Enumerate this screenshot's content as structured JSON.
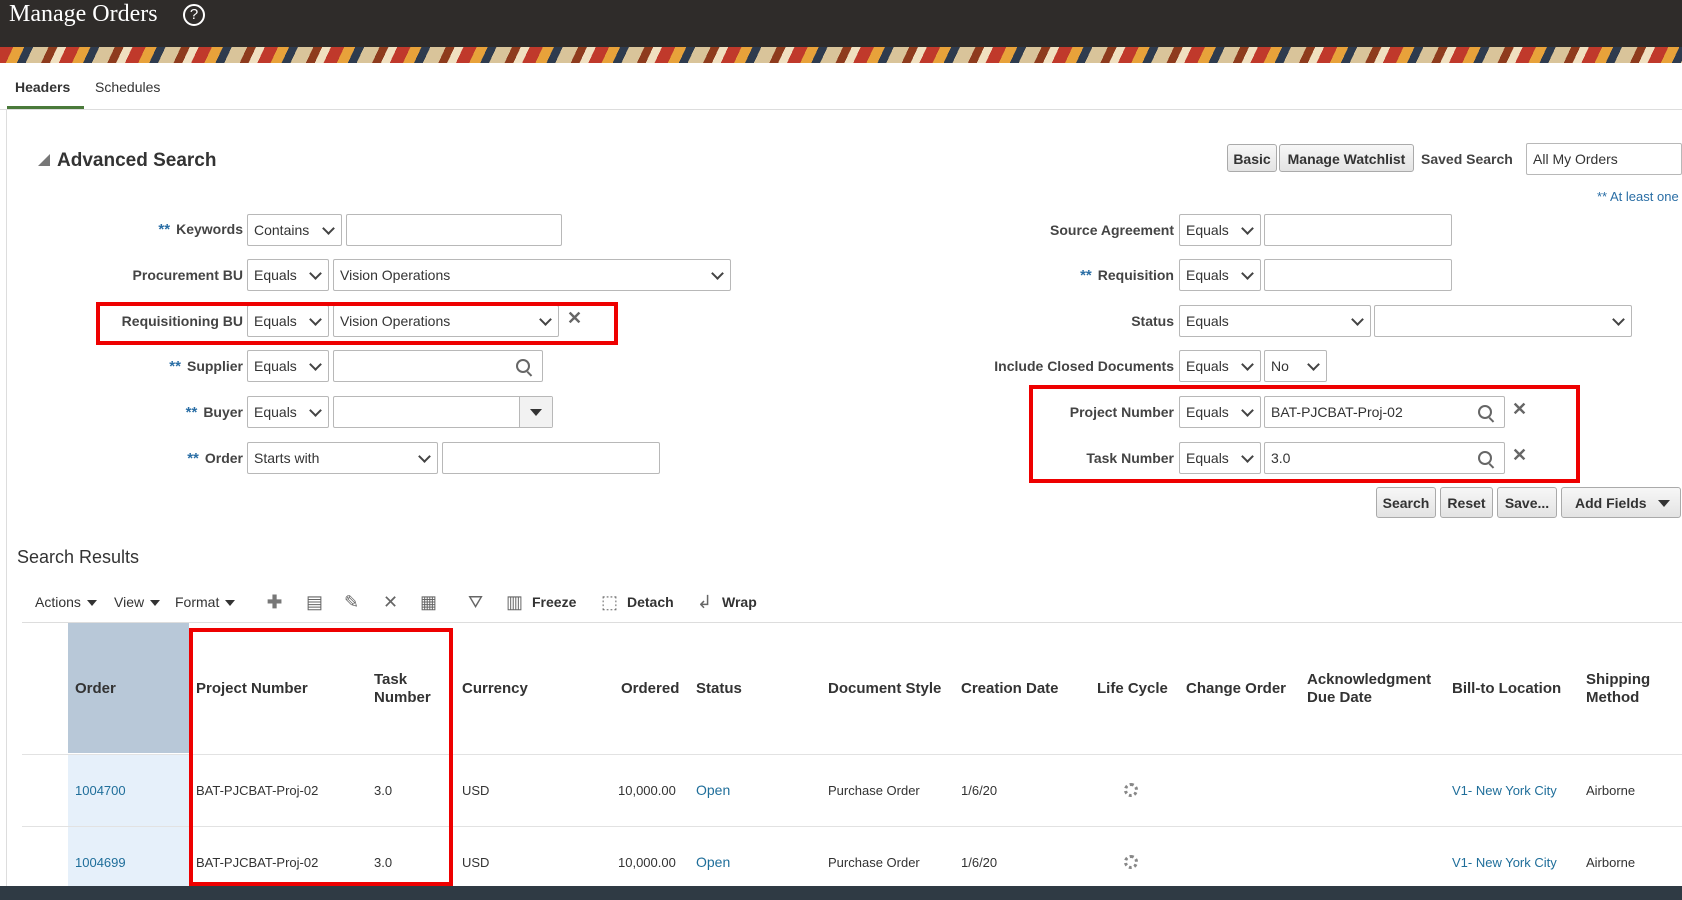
{
  "page": {
    "title": "Manage Orders",
    "help": "?"
  },
  "tabs": [
    {
      "label": "Headers"
    },
    {
      "label": "Schedules"
    }
  ],
  "advanced_search": {
    "title": "Advanced Search",
    "basic_label": "Basic",
    "manage_watchlist_label": "Manage Watchlist",
    "saved_search_label": "Saved Search",
    "saved_search_value": "All My Orders",
    "at_least_one_note": "** At least one",
    "required_marker": "**",
    "fields_left": {
      "keywords": {
        "label": "Keywords",
        "operator": "Contains",
        "value": ""
      },
      "procurement_bu": {
        "label": "Procurement BU",
        "operator": "Equals",
        "value": "Vision Operations"
      },
      "requisitioning_bu": {
        "label": "Requisitioning BU",
        "operator": "Equals",
        "value": "Vision Operations"
      },
      "supplier": {
        "label": "Supplier",
        "operator": "Equals",
        "value": ""
      },
      "buyer": {
        "label": "Buyer",
        "operator": "Equals",
        "value": ""
      },
      "order": {
        "label": "Order",
        "operator": "Starts with",
        "value": ""
      }
    },
    "fields_right": {
      "source_agreement": {
        "label": "Source Agreement",
        "operator": "Equals",
        "value": ""
      },
      "requisition": {
        "label": "Requisition",
        "operator": "Equals",
        "value": ""
      },
      "status": {
        "label": "Status",
        "operator": "Equals",
        "value": ""
      },
      "include_closed": {
        "label": "Include Closed Documents",
        "operator": "Equals",
        "value": "No"
      },
      "project_number": {
        "label": "Project Number",
        "operator": "Equals",
        "value": "BAT-PJCBAT-Proj-02"
      },
      "task_number": {
        "label": "Task Number",
        "operator": "Equals",
        "value": "3.0"
      }
    },
    "buttons": {
      "search": "Search",
      "reset": "Reset",
      "save": "Save...",
      "add_fields": "Add Fields"
    }
  },
  "results": {
    "title": "Search Results",
    "toolbar": {
      "actions": "Actions",
      "view": "View",
      "format": "Format",
      "freeze": "Freeze",
      "detach": "Detach",
      "wrap": "Wrap"
    },
    "columns": {
      "order": "Order",
      "project_number": "Project Number",
      "task_number_1": "Task",
      "task_number_2": "Number",
      "currency": "Currency",
      "ordered": "Ordered",
      "status": "Status",
      "document_style": "Document Style",
      "creation_date": "Creation Date",
      "life_cycle": "Life Cycle",
      "change_order": "Change Order",
      "ack_due_1": "Acknowledgment",
      "ack_due_2": "Due Date",
      "bill_to": "Bill-to Location",
      "shipping_1": "Shipping",
      "shipping_2": "Method"
    },
    "rows": [
      {
        "order": "1004700",
        "project_number": "BAT-PJCBAT-Proj-02",
        "task_number": "3.0",
        "currency": "USD",
        "ordered": "10,000.00",
        "status": "Open",
        "document_style": "Purchase Order",
        "creation_date": "1/6/20",
        "bill_to": "V1- New York City",
        "shipping": "Airborne"
      },
      {
        "order": "1004699",
        "project_number": "BAT-PJCBAT-Proj-02",
        "task_number": "3.0",
        "currency": "USD",
        "ordered": "10,000.00",
        "status": "Open",
        "document_style": "Purchase Order",
        "creation_date": "1/6/20",
        "bill_to": "V1- New York City",
        "shipping": "Airborne"
      }
    ]
  }
}
